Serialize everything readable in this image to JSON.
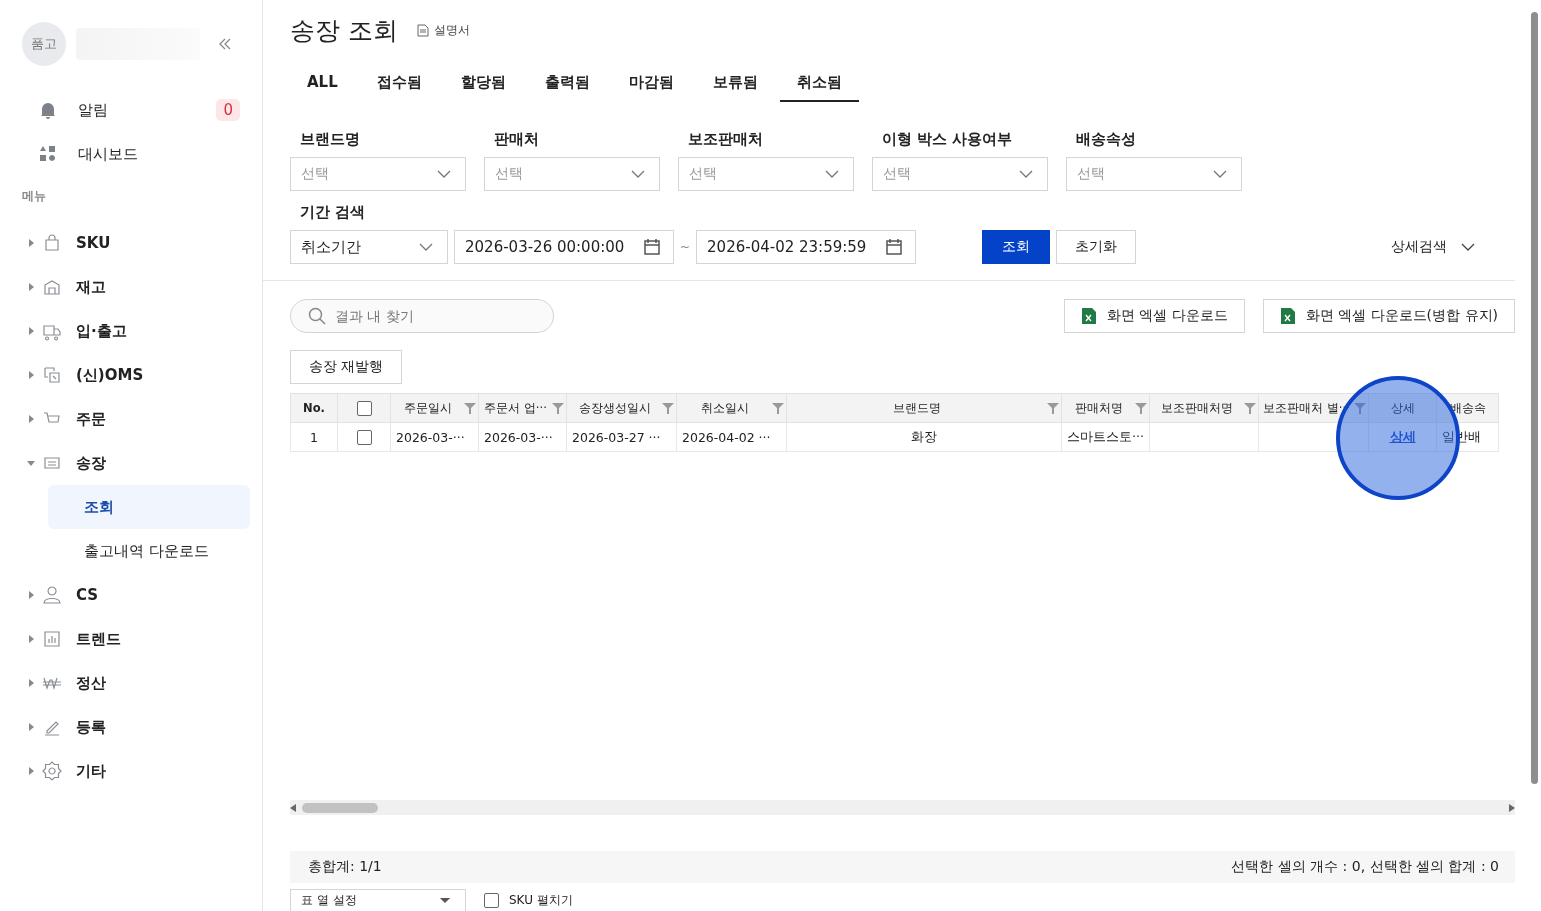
{
  "sidebar": {
    "logo_text": "품고",
    "alert": {
      "label": "알림",
      "count": "0"
    },
    "dashboard": {
      "label": "대시보드"
    },
    "section_label": "메뉴",
    "items": [
      {
        "label": "SKU",
        "expanded": false
      },
      {
        "label": "재고",
        "expanded": false
      },
      {
        "label": "입·출고",
        "expanded": false
      },
      {
        "label": "(신)OMS",
        "expanded": false
      },
      {
        "label": "주문",
        "expanded": false
      },
      {
        "label": "송장",
        "expanded": true,
        "children": [
          {
            "label": "조회",
            "selected": true
          },
          {
            "label": "출고내역 다운로드",
            "selected": false
          }
        ]
      },
      {
        "label": "CS",
        "expanded": false
      },
      {
        "label": "트렌드",
        "expanded": false
      },
      {
        "label": "정산",
        "expanded": false
      },
      {
        "label": "등록",
        "expanded": false
      },
      {
        "label": "기타",
        "expanded": false
      }
    ]
  },
  "page": {
    "title": "송장 조회",
    "manual_link": "설명서"
  },
  "tabs": [
    {
      "label": "ALL",
      "selected": false
    },
    {
      "label": "접수됨",
      "selected": false
    },
    {
      "label": "할당됨",
      "selected": false
    },
    {
      "label": "출력됨",
      "selected": false
    },
    {
      "label": "마감됨",
      "selected": false
    },
    {
      "label": "보류됨",
      "selected": false
    },
    {
      "label": "취소됨",
      "selected": true
    }
  ],
  "filters": [
    {
      "label": "브랜드명",
      "placeholder": "선택"
    },
    {
      "label": "판매처",
      "placeholder": "선택"
    },
    {
      "label": "보조판매처",
      "placeholder": "선택"
    },
    {
      "label": "이형 박스 사용여부",
      "placeholder": "선택"
    },
    {
      "label": "배송속성",
      "placeholder": "선택"
    }
  ],
  "period": {
    "label": "기간 검색",
    "type": "취소기간",
    "start": "2026-03-26 00:00:00",
    "separator": "~",
    "end": "2026-04-02 23:59:59"
  },
  "search_button": "조회",
  "reset_button": "초기화",
  "advanced_search": "상세검색",
  "result_search": {
    "placeholder": "결과 내 찾기"
  },
  "excel_buttons": [
    "화면 엑셀 다운로드",
    "화면 엑셀 다운로드(병합 유지)"
  ],
  "reissue_button": "송장 재발행",
  "table": {
    "columns": [
      {
        "kind": "number",
        "label": "No.",
        "filter": false
      },
      {
        "kind": "checkbox",
        "checked": false,
        "filter": false
      },
      {
        "kind": "text",
        "label": "주문일시",
        "filter": true
      },
      {
        "kind": "text",
        "label": "주문서 업···",
        "filter": true
      },
      {
        "kind": "text",
        "label": "송장생성일시",
        "filter": true
      },
      {
        "kind": "text",
        "label": "취소일시",
        "filter": true
      },
      {
        "kind": "text",
        "label": "브랜드명",
        "filter": true
      },
      {
        "kind": "text",
        "label": "판매처명",
        "filter": true
      },
      {
        "kind": "text",
        "label": "보조판매처명",
        "filter": true
      },
      {
        "kind": "text",
        "label": "보조판매처 별···",
        "filter": true
      },
      {
        "kind": "text",
        "label": "상세",
        "filter": false
      },
      {
        "kind": "text",
        "label": "배송속",
        "filter": false
      }
    ],
    "rows": [
      {
        "cells": [
          {
            "kind": "center",
            "text": "1"
          },
          {
            "kind": "checkbox",
            "checked": false
          },
          {
            "kind": "text",
            "text": "2026-03-···"
          },
          {
            "kind": "text",
            "text": "2026-03-···"
          },
          {
            "kind": "text",
            "text": "2026-03-27 ···"
          },
          {
            "kind": "text",
            "text": "2026-04-02 ···"
          },
          {
            "kind": "center",
            "text": "화장"
          },
          {
            "kind": "text",
            "text": "스마트스토···"
          },
          {
            "kind": "empty"
          },
          {
            "kind": "empty"
          },
          {
            "kind": "link",
            "text": "상세"
          },
          {
            "kind": "text",
            "text": "일반배"
          }
        ]
      }
    ]
  },
  "footer": {
    "total": "총합계: 1/1",
    "selection_summary": "선택한 셀의 개수 : 0, 선택한 셀의 합계 : 0",
    "column_settings": "표 열 설정",
    "sku_expand": {
      "label": "SKU 펼치기",
      "checked": false
    }
  }
}
